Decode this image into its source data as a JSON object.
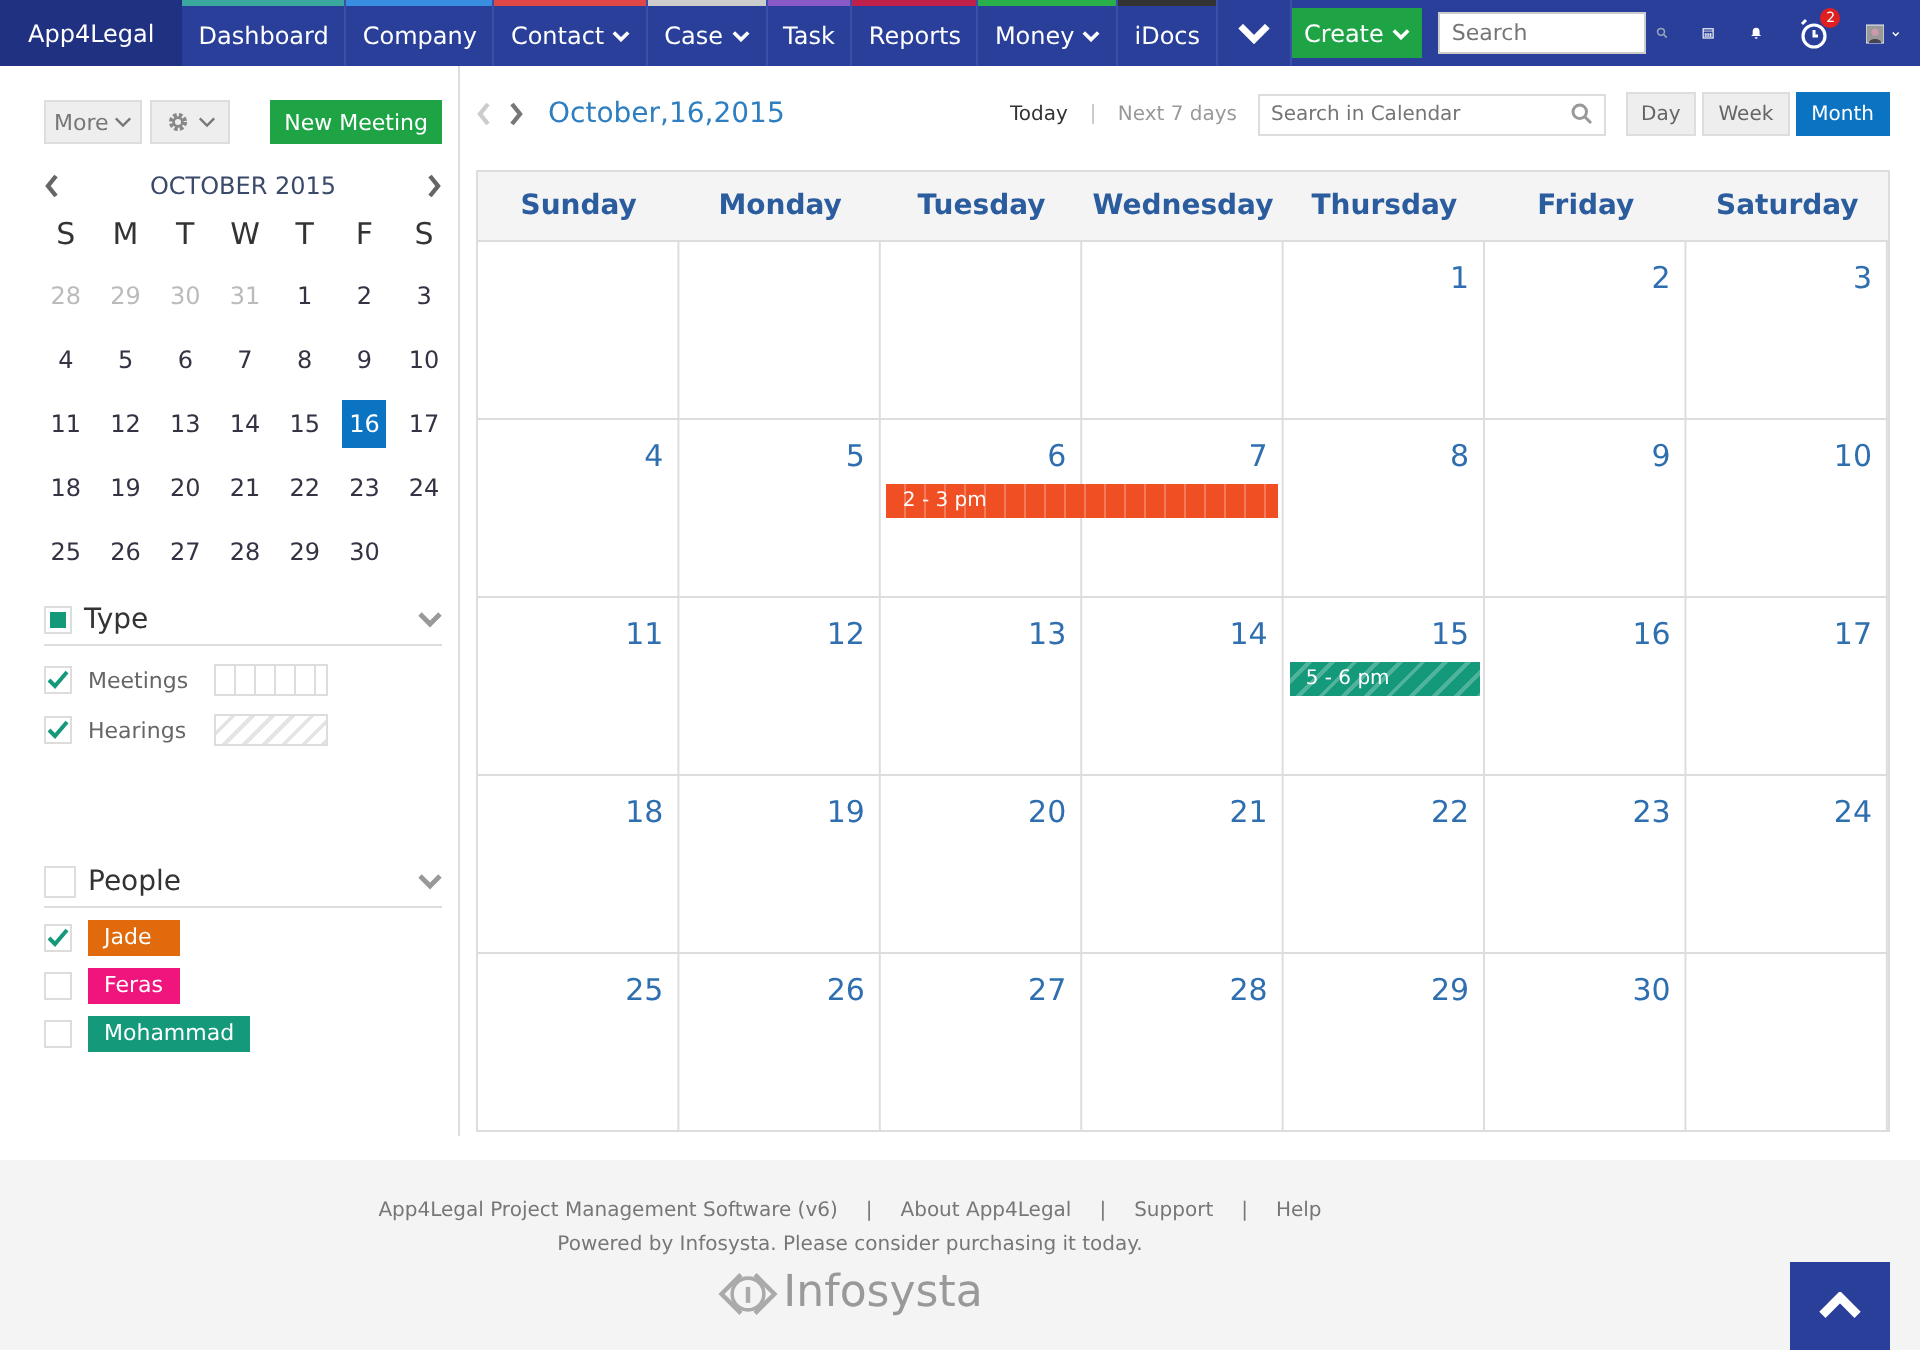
{
  "nav": {
    "brand": "App4Legal",
    "items": [
      {
        "label": "Dashboard",
        "color": "#3aa89c",
        "has_menu": false
      },
      {
        "label": "Company",
        "color": "#3a8ee0",
        "has_menu": false
      },
      {
        "label": "Contact",
        "color": "#e04848",
        "has_menu": true
      },
      {
        "label": "Case",
        "color": "#cccccc",
        "has_menu": true
      },
      {
        "label": "Task",
        "color": "#8a5ac8",
        "has_menu": false
      },
      {
        "label": "Reports",
        "color": "#c0204a",
        "has_menu": false
      },
      {
        "label": "Money",
        "color": "#2ab04a",
        "has_menu": true
      },
      {
        "label": "iDocs",
        "color": "#333333",
        "has_menu": false
      }
    ],
    "create": "Create",
    "search": {
      "placeholder": "Search"
    },
    "alarm_badge": "2"
  },
  "sidebar": {
    "more": "More",
    "new_meeting": "New Meeting",
    "month_title": "OCTOBER 2015",
    "weekdays": [
      "S",
      "M",
      "T",
      "W",
      "T",
      "F",
      "S"
    ],
    "weeks": [
      [
        {
          "d": "28",
          "muted": true,
          "selected": false
        },
        {
          "d": "29",
          "muted": true,
          "selected": false
        },
        {
          "d": "30",
          "muted": true,
          "selected": false
        },
        {
          "d": "31",
          "muted": true,
          "selected": false
        },
        {
          "d": "1",
          "muted": false,
          "selected": false
        },
        {
          "d": "2",
          "muted": false,
          "selected": false
        },
        {
          "d": "3",
          "muted": false,
          "selected": false
        }
      ],
      [
        {
          "d": "4",
          "muted": false,
          "selected": false
        },
        {
          "d": "5",
          "muted": false,
          "selected": false
        },
        {
          "d": "6",
          "muted": false,
          "selected": false
        },
        {
          "d": "7",
          "muted": false,
          "selected": false
        },
        {
          "d": "8",
          "muted": false,
          "selected": false
        },
        {
          "d": "9",
          "muted": false,
          "selected": false
        },
        {
          "d": "10",
          "muted": false,
          "selected": false
        }
      ],
      [
        {
          "d": "11",
          "muted": false,
          "selected": false
        },
        {
          "d": "12",
          "muted": false,
          "selected": false
        },
        {
          "d": "13",
          "muted": false,
          "selected": false
        },
        {
          "d": "14",
          "muted": false,
          "selected": false
        },
        {
          "d": "15",
          "muted": false,
          "selected": false
        },
        {
          "d": "16",
          "muted": false,
          "selected": true
        },
        {
          "d": "17",
          "muted": false,
          "selected": false
        }
      ],
      [
        {
          "d": "18",
          "muted": false,
          "selected": false
        },
        {
          "d": "19",
          "muted": false,
          "selected": false
        },
        {
          "d": "20",
          "muted": false,
          "selected": false
        },
        {
          "d": "21",
          "muted": false,
          "selected": false
        },
        {
          "d": "22",
          "muted": false,
          "selected": false
        },
        {
          "d": "23",
          "muted": false,
          "selected": false
        },
        {
          "d": "24",
          "muted": false,
          "selected": false
        }
      ],
      [
        {
          "d": "25",
          "muted": false,
          "selected": false
        },
        {
          "d": "26",
          "muted": false,
          "selected": false
        },
        {
          "d": "27",
          "muted": false,
          "selected": false
        },
        {
          "d": "28",
          "muted": false,
          "selected": false
        },
        {
          "d": "29",
          "muted": false,
          "selected": false
        },
        {
          "d": "30",
          "muted": false,
          "selected": false
        }
      ]
    ],
    "type": {
      "title": "Type",
      "checked": true,
      "items": [
        {
          "label": "Meetings",
          "checked": true,
          "kind": "meeting"
        },
        {
          "label": "Hearings",
          "checked": true,
          "kind": "hearing"
        }
      ]
    },
    "people": {
      "title": "People",
      "checked": false,
      "items": [
        {
          "name": "Jade",
          "checked": true,
          "color": "#e06a0c"
        },
        {
          "name": "Feras",
          "checked": false,
          "color": "#f0157d"
        },
        {
          "name": "Mohammad",
          "checked": false,
          "color": "#14997a"
        }
      ]
    }
  },
  "calendar": {
    "current_date": "October,16,2015",
    "today": "Today",
    "next_7_days": "Next 7 days",
    "search": {
      "placeholder": "Search in Calendar"
    },
    "views": [
      {
        "label": "Day",
        "selected": false
      },
      {
        "label": "Week",
        "selected": false
      },
      {
        "label": "Month",
        "selected": true
      }
    ],
    "weekdays": [
      "Sunday",
      "Monday",
      "Tuesday",
      "Wednesday",
      "Thursday",
      "Friday",
      "Saturday"
    ],
    "weeks": [
      [
        {
          "d": "1"
        },
        {
          "d": "2"
        },
        {
          "d": "3"
        }
      ],
      [
        {
          "d": "4"
        },
        {
          "d": "5"
        },
        {
          "d": "6",
          "event": {
            "label": "2 - 3 pm",
            "kind": "meeting",
            "color": "#f04e23"
          }
        },
        {
          "d": "7",
          "continues_event": true
        },
        {
          "d": "8"
        },
        {
          "d": "9"
        },
        {
          "d": "10"
        }
      ],
      [
        {
          "d": "11"
        },
        {
          "d": "12"
        },
        {
          "d": "13"
        },
        {
          "d": "14"
        },
        {
          "d": "15",
          "event": {
            "label": "5 - 6 pm",
            "kind": "hearing",
            "color": "#14997a"
          }
        },
        {
          "d": "16"
        },
        {
          "d": "17"
        }
      ],
      [
        {
          "d": "18"
        },
        {
          "d": "19"
        },
        {
          "d": "20"
        },
        {
          "d": "21"
        },
        {
          "d": "22"
        },
        {
          "d": "23"
        },
        {
          "d": "24"
        }
      ],
      [
        {
          "d": "25"
        },
        {
          "d": "26"
        },
        {
          "d": "27"
        },
        {
          "d": "28"
        },
        {
          "d": "29"
        },
        {
          "d": "30"
        }
      ]
    ]
  },
  "footer": {
    "links": [
      "App4Legal Project Management Software (v6)",
      "About App4Legal",
      "Support",
      "Help"
    ],
    "separator": "|",
    "powered": "Powered by Infosysta. Please consider purchasing it today.",
    "logo": "Infosysta"
  }
}
